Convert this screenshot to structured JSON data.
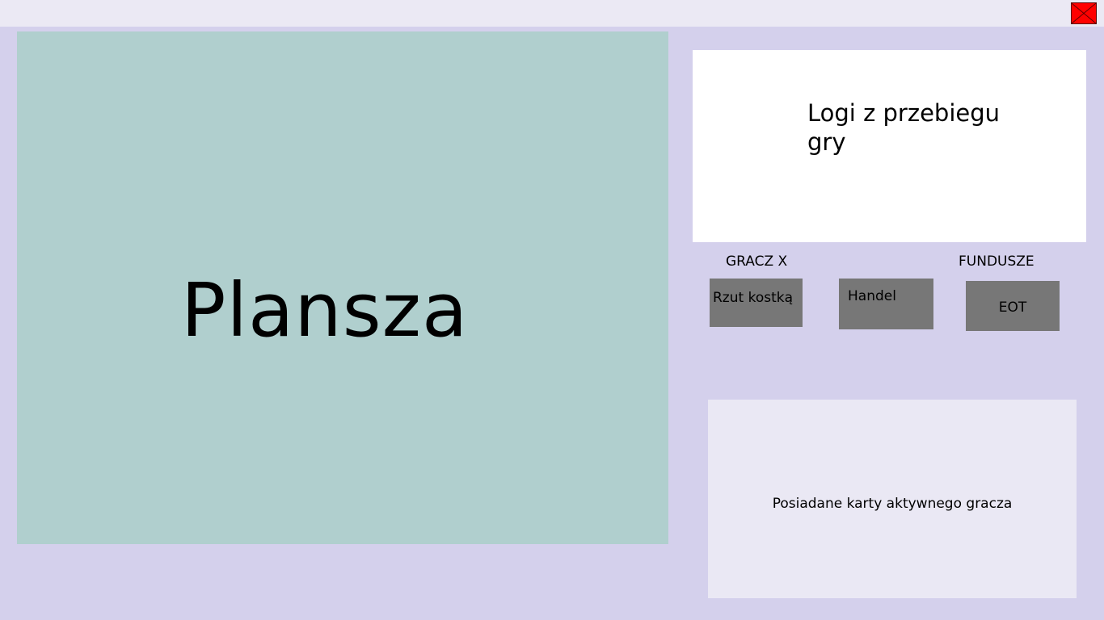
{
  "window": {
    "close_icon": "close-x-icon",
    "close_color": "#ff0000"
  },
  "board": {
    "label": "Plansza",
    "color": "#b0cfce"
  },
  "log": {
    "label": "Logi z przebiegu gry"
  },
  "status": {
    "player": "GRACZ X",
    "funds": "FUNDUSZE"
  },
  "actions": {
    "roll_dice": "Rzut kostką",
    "trade": "Handel",
    "end_turn": "EOT"
  },
  "cards": {
    "label": "Posiadane karty aktywnego gracza"
  },
  "colors": {
    "background": "#d4d0ec",
    "button": "#777777",
    "panel": "#eae8f4"
  }
}
